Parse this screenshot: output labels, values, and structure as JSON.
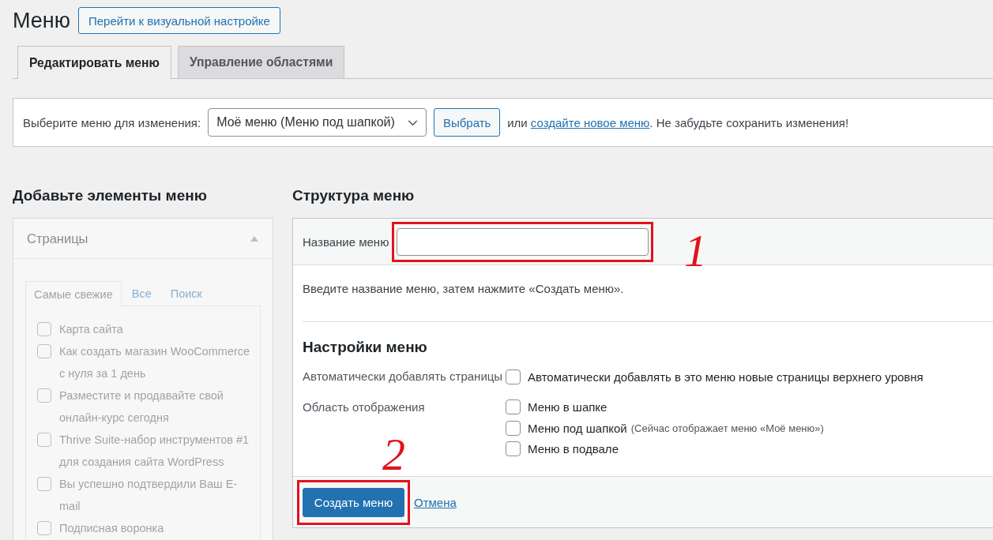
{
  "page": {
    "title": "Меню",
    "customize_button": "Перейти к визуальной настройке"
  },
  "tabs": [
    {
      "label": "Редактировать меню",
      "selected": true
    },
    {
      "label": "Управление областями",
      "selected": false
    }
  ],
  "menu_select_bar": {
    "label": "Выберите меню для изменения:",
    "select_value": "Моё меню (Меню под шапкой)",
    "select_button": "Выбрать",
    "note": {
      "before": "или ",
      "link": "создайте новое меню",
      "after": ". Не забудьте сохранить изменения!"
    }
  },
  "add_items": {
    "title": "Добавьте элементы меню",
    "disabled": true,
    "panel": {
      "title": "Страницы",
      "expanded": true,
      "tabs": [
        {
          "label": "Самые свежие",
          "selected": true
        },
        {
          "label": "Все",
          "selected": false
        },
        {
          "label": "Поиск",
          "selected": false
        }
      ],
      "items": [
        {
          "label": "Карта сайта",
          "checked": false
        },
        {
          "label": "Как создать магазин WooCommerce с нуля за 1 день",
          "checked": false
        },
        {
          "label": "Разместите и продавайте свой онлайн-курс сегодня",
          "checked": false
        },
        {
          "label": "Thrive Suite-набор инструментов #1 для создания сайта WordPress",
          "checked": false
        },
        {
          "label": "Вы успешно подтвердили Ваш E-mail",
          "checked": false
        },
        {
          "label": "Подписная воронка",
          "checked": false
        }
      ]
    }
  },
  "structure": {
    "title": "Структура меню",
    "name_label": "Название меню",
    "name_field": {
      "highlighted": true,
      "annotation": "1"
    },
    "instructions": "Введите название меню, затем нажмите «Создать меню».",
    "settings": {
      "title": "Настройки меню",
      "rows": [
        {
          "label": "Автоматически добавлять страницы",
          "options": [
            {
              "label": "Автоматически добавлять в это меню новые страницы верхнего уровня",
              "checked": false
            }
          ]
        },
        {
          "label": "Область отображения",
          "options": [
            {
              "label": "Меню в шапке",
              "checked": false
            },
            {
              "label": "Меню под шапкой",
              "note": "(Сейчас отображает меню «Моё меню»)",
              "checked": false
            },
            {
              "label": "Меню в подвале",
              "checked": false
            }
          ]
        }
      ]
    },
    "footer": {
      "create_button": {
        "label": "Создать меню",
        "highlighted": true,
        "annotation": "2"
      },
      "cancel_link": "Отмена"
    }
  }
}
